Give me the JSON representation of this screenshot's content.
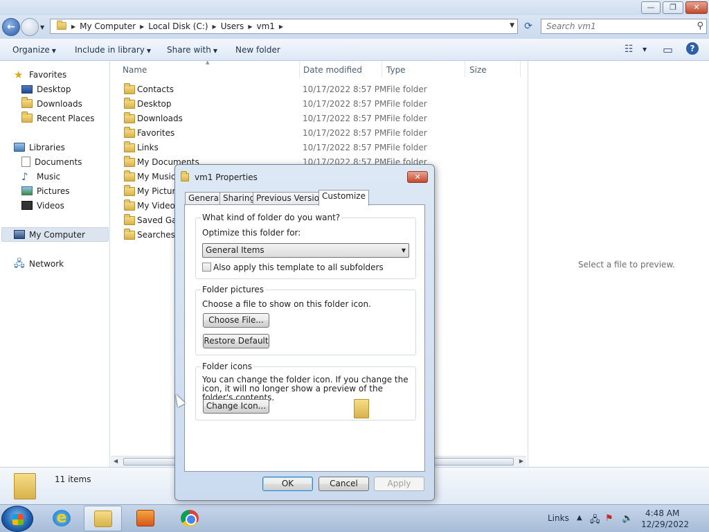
{
  "window": {
    "minimize": "—",
    "maximize": "❐",
    "close": "✕"
  },
  "address": {
    "crumbs": [
      "My Computer",
      "Local Disk (C:)",
      "Users",
      "vm1"
    ],
    "search_placeholder": "Search vm1"
  },
  "toolbar": {
    "organize": "Organize",
    "include_in_library": "Include in library",
    "share_with": "Share with",
    "new_folder": "New folder"
  },
  "nav": {
    "favorites": "Favorites",
    "desktop": "Desktop",
    "downloads": "Downloads",
    "recent_places": "Recent Places",
    "libraries": "Libraries",
    "documents": "Documents",
    "music": "Music",
    "pictures": "Pictures",
    "videos": "Videos",
    "my_computer": "My Computer",
    "network": "Network"
  },
  "columns": {
    "name": "Name",
    "date_modified": "Date modified",
    "type": "Type",
    "size": "Size"
  },
  "files": [
    {
      "name": "Contacts",
      "date": "10/17/2022 8:57 PM",
      "type": "File folder"
    },
    {
      "name": "Desktop",
      "date": "10/17/2022 8:57 PM",
      "type": "File folder"
    },
    {
      "name": "Downloads",
      "date": "10/17/2022 8:57 PM",
      "type": "File folder"
    },
    {
      "name": "Favorites",
      "date": "10/17/2022 8:57 PM",
      "type": "File folder"
    },
    {
      "name": "Links",
      "date": "10/17/2022 8:57 PM",
      "type": "File folder"
    },
    {
      "name": "My Documents",
      "date": "10/17/2022 8:57 PM",
      "type": "File folder"
    },
    {
      "name": "My Music",
      "date": "",
      "type": ""
    },
    {
      "name": "My Pictures",
      "date": "",
      "type": ""
    },
    {
      "name": "My Videos",
      "date": "",
      "type": ""
    },
    {
      "name": "Saved Games",
      "date": "",
      "type": ""
    },
    {
      "name": "Searches",
      "date": "",
      "type": ""
    }
  ],
  "preview": {
    "message": "Select a file to preview."
  },
  "details": {
    "count": "11 items"
  },
  "dialog": {
    "title": "vm1 Properties",
    "close": "✕",
    "tabs": [
      "General",
      "Sharing",
      "Previous Versions",
      "Customize"
    ],
    "active_tab": "Customize",
    "group1_label": "What kind of folder do you want?",
    "optimize_label": "Optimize this folder for:",
    "optimize_value": "General Items",
    "subfolders_label": "Also apply this template to all subfolders",
    "group2_label": "Folder pictures",
    "choose_text": "Choose a file to show on this folder icon.",
    "choose_file": "Choose File...",
    "restore_default": "Restore Default",
    "group3_label": "Folder icons",
    "icons_text": "You can change the folder icon. If you change the icon, it will no longer show a preview of the folder's contents.",
    "change_icon": "Change Icon...",
    "ok": "OK",
    "cancel": "Cancel",
    "apply": "Apply"
  },
  "taskbar": {
    "links": "Links",
    "time": "4:48 AM",
    "date": "12/29/2022"
  }
}
